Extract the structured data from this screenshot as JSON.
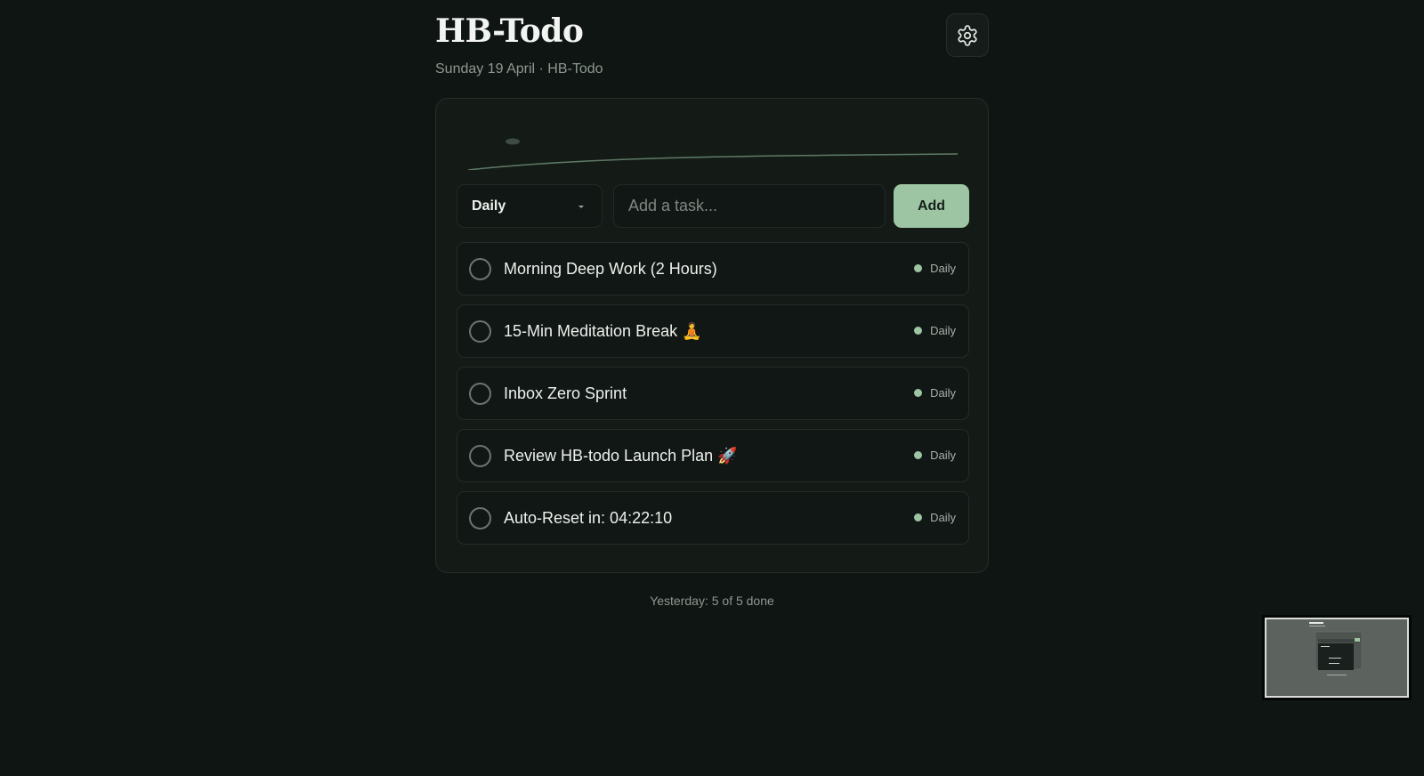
{
  "header": {
    "title": "HB-Todo",
    "subtitle": "Sunday 19 April · HB-Todo",
    "settings_icon": "gear-icon"
  },
  "controls": {
    "frequency_selected": "Daily",
    "task_placeholder": "Add a task...",
    "add_label": "Add"
  },
  "tasks": [
    {
      "text": "Morning Deep Work (2 Hours)",
      "tag": "Daily",
      "done": false
    },
    {
      "text": "15-Min Meditation Break 🧘",
      "tag": "Daily",
      "done": false
    },
    {
      "text": "Inbox Zero Sprint",
      "tag": "Daily",
      "done": false
    },
    {
      "text": "Review HB-todo Launch Plan 🚀",
      "tag": "Daily",
      "done": false
    },
    {
      "text": "Auto-Reset in: 04:22:10",
      "tag": "Daily",
      "done": false
    }
  ],
  "footer": {
    "summary": "Yesterday: 5 of 5 done"
  },
  "colors": {
    "background": "#0f1512",
    "card": "#141b17",
    "accent": "#9ec5a3"
  }
}
